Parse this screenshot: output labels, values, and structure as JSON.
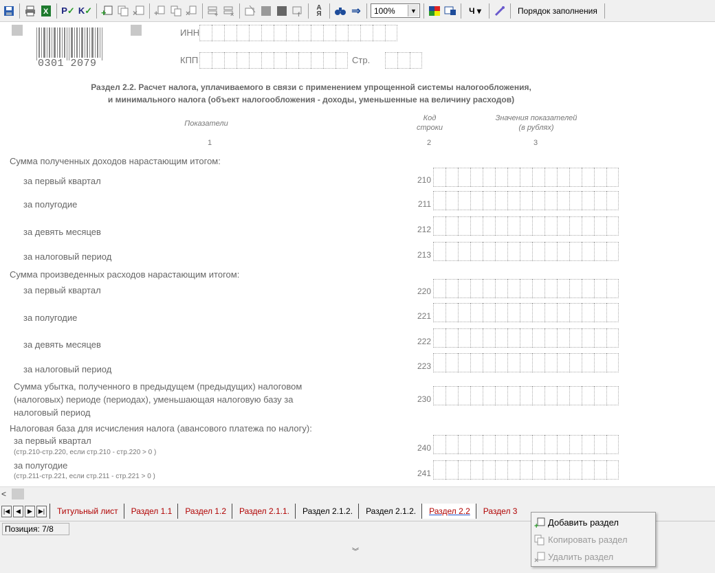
{
  "toolbar": {
    "zoom_value": "100%",
    "order_label": "Порядок заполнения",
    "icons": [
      "save-icon",
      "print-icon",
      "excel-icon",
      "check-p-icon",
      "check-k-icon",
      "add-section-icon",
      "copy-section-icon",
      "delete-section-icon",
      "add-page-icon",
      "copy-page-icon",
      "delete-page-icon",
      "add-row-icon",
      "delete-row-icon",
      "clear-icon",
      "fill-icon",
      "fill-dark-icon",
      "format-icon",
      "sort-icon",
      "find-icon",
      "goto-icon",
      "color-select-icon",
      "color-pick-icon",
      "font-icon",
      "settings-icon"
    ]
  },
  "form": {
    "barcode_number": "0301 2079",
    "inn_label": "ИНН",
    "kpp_label": "КПП",
    "page_label": "Стр.",
    "section_title_line1": "Раздел 2.2. Расчет налога, уплачиваемого в связи с применением упрощенной системы налогообложения,",
    "section_title_line2": "и минимального налога (объект налогообложения - доходы, уменьшенные на величину расходов)",
    "col1_header": "Показатели",
    "col2_header_line1": "Код",
    "col2_header_line2": "строки",
    "col3_header_line1": "Значения показателей",
    "col3_header_line2": "(в рублях)",
    "col_num1": "1",
    "col_num2": "2",
    "col_num3": "3",
    "group_income": "Сумма полученных доходов нарастающим итогом:",
    "group_expense": "Сумма произведенных расходов нарастающим итогом:",
    "group_base": "Налоговая база для исчисления налога (авансового платежа по налогу):",
    "rows": [
      {
        "label": "за первый квартал",
        "code": "210"
      },
      {
        "label": "за полугодие",
        "code": "211"
      },
      {
        "label": "за девять месяцев",
        "code": "212"
      },
      {
        "label": "за налоговый период",
        "code": "213"
      },
      {
        "label": "за первый квартал",
        "code": "220"
      },
      {
        "label": "за полугодие",
        "code": "221"
      },
      {
        "label": "за девять месяцев",
        "code": "222"
      },
      {
        "label": "за налоговый период",
        "code": "223"
      }
    ],
    "loss_line1": "Сумма убытка, полученного в предыдущем (предыдущих) налоговом",
    "loss_line2": "(налоговых) периоде (периодах), уменьшающая налоговую базу за",
    "loss_line3": "налоговый период",
    "loss_code": "230",
    "base_rows": [
      {
        "label": "за первый квартал",
        "note": "(стр.210-стр.220, если стр.210 - стр.220 > 0 )",
        "code": "240"
      },
      {
        "label": "за полугодие",
        "note": "(стр.211-стр.221, если стр.211 - стр.221 > 0 )",
        "code": "241"
      }
    ]
  },
  "tabs": [
    {
      "label": "Титульный лист",
      "color": "red"
    },
    {
      "label": "Раздел 1.1",
      "color": "red"
    },
    {
      "label": "Раздел 1.2",
      "color": "red"
    },
    {
      "label": "Раздел 2.1.1.",
      "color": "red"
    },
    {
      "label": "Раздел 2.1.2.",
      "color": "black"
    },
    {
      "label": "Раздел 2.1.2.",
      "color": "black"
    },
    {
      "label": "Раздел 2.2",
      "color": "active"
    },
    {
      "label": "Раздел 3",
      "color": "red"
    }
  ],
  "status": {
    "position": "Позиция: 7/8"
  },
  "context_menu": {
    "add": "Добавить раздел",
    "copy": "Копировать раздел",
    "delete": "Удалить раздел"
  }
}
